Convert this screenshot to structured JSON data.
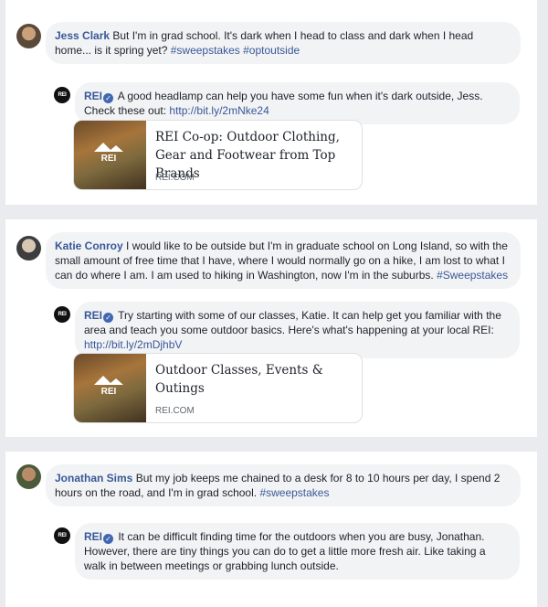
{
  "threads": [
    {
      "comment": {
        "author": "Jess Clark",
        "text": " But I'm in grad school. It's dark when I head to class and dark when I head home... is it spring yet? ",
        "hashtags": [
          "#sweepstakes",
          "#optoutside"
        ]
      },
      "reply": {
        "author": "REI",
        "text": " A good headlamp can help you have some fun when it's dark outside, Jess. Check these out: ",
        "link": "http://bit.ly/2mNke24"
      },
      "card": {
        "title": "REI Co-op: Outdoor Clothing, Gear and Footwear from Top Brands",
        "domain": "REI.COM"
      }
    },
    {
      "comment": {
        "author": "Katie Conroy",
        "text": " I would like to be outside but I'm in graduate school on Long Island, so with the small amount of free time that I have, where I would normally go on a hike, I am lost to what I can do where I am. I am used to hiking in Washington, now I'm in the suburbs. ",
        "hashtags": [
          "#Sweepstakes"
        ]
      },
      "reply": {
        "author": "REI",
        "text": " Try starting with some of our classes, Katie. It can help get you familiar with the area and teach you some outdoor basics. Here's what's happening at your local REI: ",
        "link": "http://bit.ly/2mDjhbV"
      },
      "card": {
        "title": "Outdoor Classes, Events & Outings",
        "domain": "REI.COM"
      }
    },
    {
      "comment": {
        "author": "Jonathan Sims",
        "text": " But my job keeps me chained to a desk for 8 to 10 hours per day, I spend 2 hours on the road, and I'm in grad school. ",
        "hashtags": [
          "#sweepstakes"
        ]
      },
      "reply": {
        "author": "REI",
        "text": " It can be difficult finding time for the outdoors when you are busy, Jonathan. However, there are tiny things you can do to get a little more fresh air. Like taking a walk in between meetings or grabbing lunch outside.",
        "link": ""
      }
    }
  ],
  "icons": {
    "verified": "verified-check-icon",
    "rei_logo": "REI"
  },
  "colors": {
    "link": "#385898",
    "bubble": "#f2f3f5",
    "background": "#e9ebee",
    "verified": "#4267b2"
  }
}
